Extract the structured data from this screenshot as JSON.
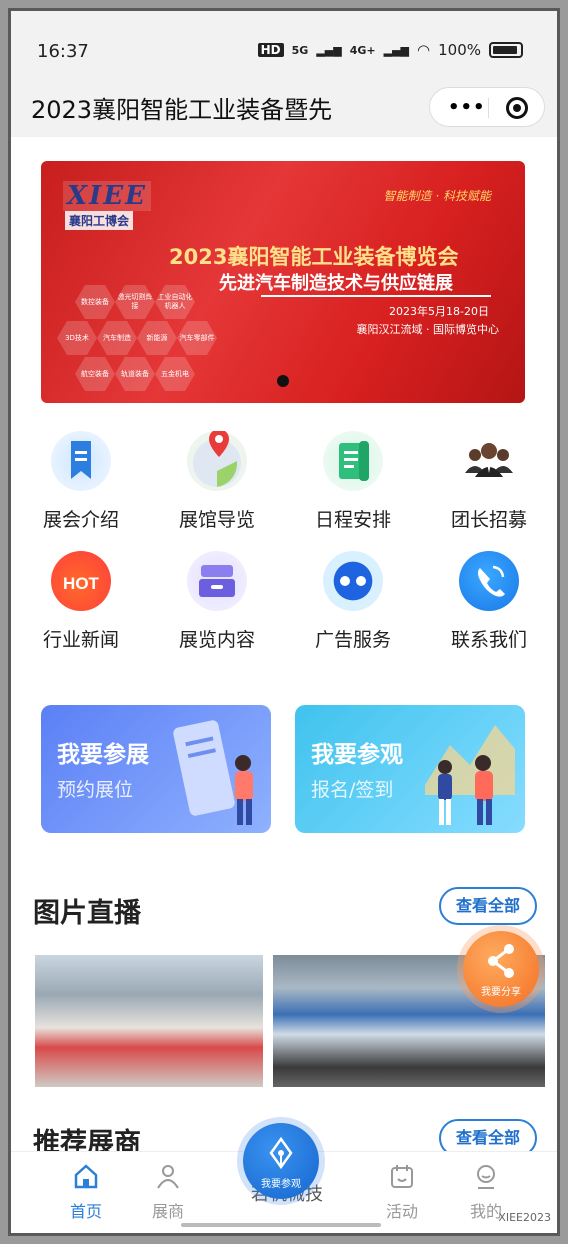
{
  "status": {
    "time": "16:37",
    "network1": "5G",
    "network2": "4G+",
    "battery": "100%"
  },
  "header": {
    "title": "2023襄阳智能工业装备暨先"
  },
  "banner": {
    "logo": "XIEE",
    "logo_sub": "襄阳工博会",
    "slogan": "智能制造 · 科技赋能",
    "title": "2023襄阳智能工业装备博览会",
    "subtitle": "先进汽车制造技术与供应链展",
    "date": "2023年5月18-20日",
    "venue": "襄阳汉江流域 · 国际博览中心",
    "tags": [
      "数控装备",
      "激光切割焊接",
      "工业自动化机器人",
      "3D技术",
      "汽车制造",
      "新能源",
      "汽车零部件",
      "航空装备",
      "轨道装备",
      "五金机电"
    ]
  },
  "menu": [
    {
      "label": "展会介绍",
      "icon": "bookmark-icon"
    },
    {
      "label": "展馆导览",
      "icon": "map-pin-icon"
    },
    {
      "label": "日程安排",
      "icon": "scroll-icon"
    },
    {
      "label": "团长招募",
      "icon": "people-icon"
    },
    {
      "label": "行业新闻",
      "icon": "hot-icon"
    },
    {
      "label": "展览内容",
      "icon": "drawer-icon"
    },
    {
      "label": "广告服务",
      "icon": "dots-icon"
    },
    {
      "label": "联系我们",
      "icon": "phone-icon"
    }
  ],
  "cards": {
    "exhibit": {
      "title": "我要参展",
      "sub": "预约展位"
    },
    "visit": {
      "title": "我要参观",
      "sub": "报名/签到"
    }
  },
  "photo_section": {
    "title": "图片直播",
    "see_all": "查看全部"
  },
  "exhibitor_section": {
    "title": "推荐展商",
    "see_all": "查看全部"
  },
  "share": {
    "label": "我要分享"
  },
  "tabbar": {
    "home": "首页",
    "exhibitors": "展商",
    "center_text": "若机械技",
    "fab_label": "我要参观",
    "events": "活动",
    "mine": "我的"
  },
  "watermark": "XIEE2023",
  "colors": {
    "accent": "#2a7fd8",
    "banner_red": "#d82020",
    "share_orange": "#f26f22"
  }
}
